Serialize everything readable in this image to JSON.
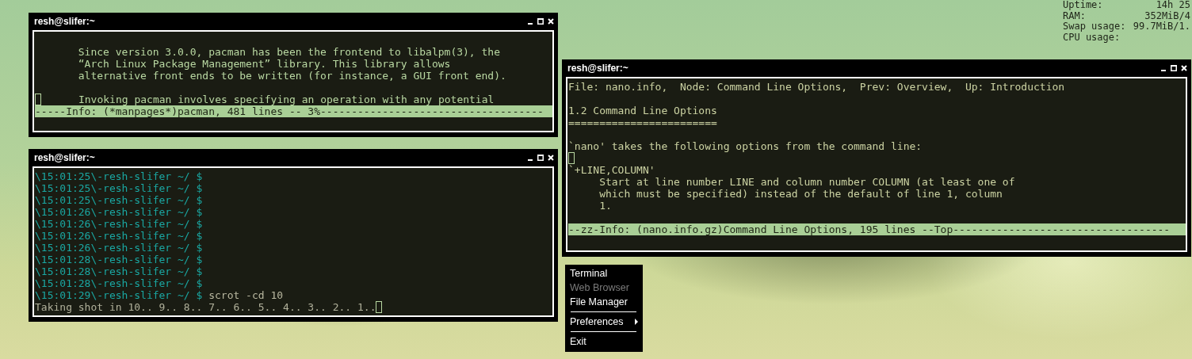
{
  "conky": [
    {
      "label": "Uptime:",
      "value": "14h 25"
    },
    {
      "label": "RAM:",
      "value": "352MiB/4"
    },
    {
      "label": "Swap usage:",
      "value": "99.7MiB/1."
    },
    {
      "label": "CPU usage:"
    }
  ],
  "windows": [
    {
      "title": "resh@slifer:~",
      "lines": [
        {
          "kind": "blank"
        },
        {
          "kind": "text",
          "text": "       Since version 3.0.0, pacman has been the frontend to libalpm(3), the"
        },
        {
          "kind": "text",
          "text": "       “Arch Linux Package Management” library. This library allows"
        },
        {
          "kind": "text",
          "text": "       alternative front ends to be written (for instance, a GUI front end)."
        },
        {
          "kind": "blank"
        },
        {
          "kind": "cursor",
          "text": "      Invoking pacman involves specifying an operation with any potential"
        },
        {
          "kind": "status",
          "text": "-----Info: (*manpages*)pacman, 481 lines -- 3%------------------------------------"
        }
      ]
    },
    {
      "title": "resh@slifer:~",
      "lines": [
        {
          "kind": "prompt",
          "prompt": "\\15:01:25\\-resh-slifer ~/ $"
        },
        {
          "kind": "prompt",
          "prompt": "\\15:01:25\\-resh-slifer ~/ $"
        },
        {
          "kind": "prompt",
          "prompt": "\\15:01:25\\-resh-slifer ~/ $"
        },
        {
          "kind": "prompt",
          "prompt": "\\15:01:26\\-resh-slifer ~/ $"
        },
        {
          "kind": "prompt",
          "prompt": "\\15:01:26\\-resh-slifer ~/ $"
        },
        {
          "kind": "prompt",
          "prompt": "\\15:01:26\\-resh-slifer ~/ $"
        },
        {
          "kind": "prompt",
          "prompt": "\\15:01:26\\-resh-slifer ~/ $"
        },
        {
          "kind": "prompt",
          "prompt": "\\15:01:28\\-resh-slifer ~/ $"
        },
        {
          "kind": "prompt",
          "prompt": "\\15:01:28\\-resh-slifer ~/ $"
        },
        {
          "kind": "prompt",
          "prompt": "\\15:01:28\\-resh-slifer ~/ $"
        },
        {
          "kind": "prompt",
          "prompt": "\\15:01:29\\-resh-slifer ~/ $",
          "command": "scrot -cd 10"
        },
        {
          "kind": "output",
          "text": "Taking shot in 10.. 9.. 8.. 7.. 6.. 5.. 4.. 3.. 2.. 1.."
        }
      ]
    },
    {
      "title": "resh@slifer:~",
      "lines": [
        {
          "kind": "text",
          "text": "File: nano.info,  Node: Command Line Options,  Prev: Overview,  Up: Introduction"
        },
        {
          "kind": "blank"
        },
        {
          "kind": "text",
          "text": "1.2 Command Line Options"
        },
        {
          "kind": "text",
          "text": "========================"
        },
        {
          "kind": "blank"
        },
        {
          "kind": "text",
          "text": "`nano' takes the following options from the command line:"
        },
        {
          "kind": "cursor"
        },
        {
          "kind": "text",
          "text": "`+LINE,COLUMN'"
        },
        {
          "kind": "text",
          "text": "     Start at line number LINE and column number COLUMN (at least one of"
        },
        {
          "kind": "text",
          "text": "     which must be specified) instead of the default of line 1, column"
        },
        {
          "kind": "text",
          "text": "     1."
        },
        {
          "kind": "blank"
        },
        {
          "kind": "status",
          "text": "--zz-Info: (nano.info.gz)Command Line Options, 195 lines --Top-----------------------------------"
        }
      ]
    }
  ],
  "menu": [
    {
      "kind": "item",
      "label": "Terminal",
      "disabled": false
    },
    {
      "kind": "item",
      "label": "Web Browser",
      "disabled": true
    },
    {
      "kind": "item",
      "label": "File Manager",
      "disabled": false
    },
    {
      "kind": "separator"
    },
    {
      "kind": "submenu",
      "label": "Preferences",
      "disabled": false
    },
    {
      "kind": "separator"
    },
    {
      "kind": "item",
      "label": "Exit",
      "disabled": false
    }
  ]
}
